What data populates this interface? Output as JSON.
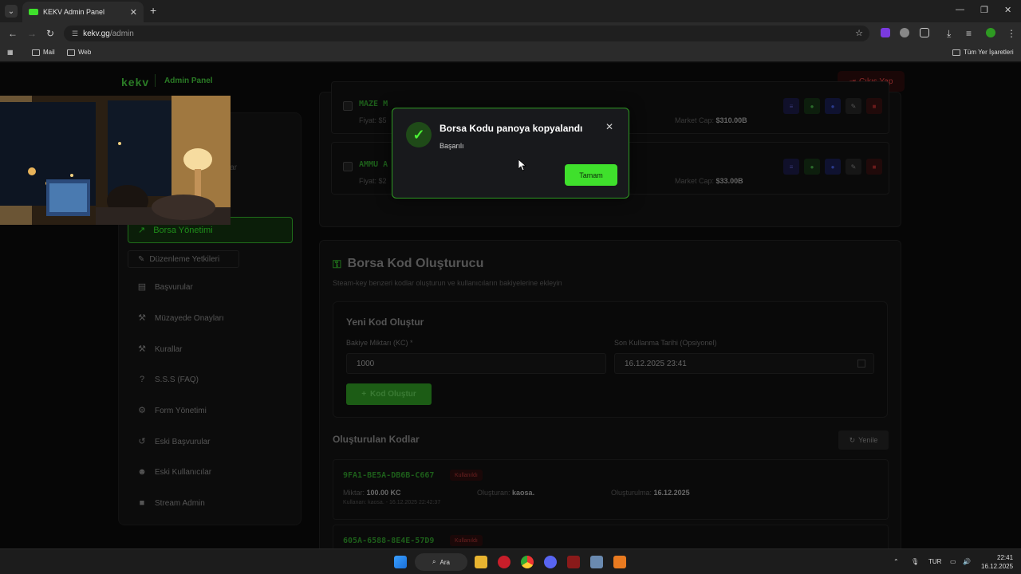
{
  "browser": {
    "tab_title": "KEKV Admin Panel",
    "url_host": "kekv.gg",
    "url_path": "/admin",
    "bookmarks": [
      "Mail",
      "Web"
    ],
    "all_bookmarks": "Tüm Yer İşaretleri"
  },
  "header": {
    "logo": "kekv",
    "title": "Admin Panel",
    "logout": "Çıkış Yap"
  },
  "sidebar": {
    "ghost_text": "lar",
    "active": "Borsa Yönetimi",
    "permissions": "Düzenleme Yetkileri",
    "items": [
      {
        "label": "Başvurular",
        "icon": "document-icon"
      },
      {
        "label": "Müzayede Onayları",
        "icon": "gavel-icon"
      },
      {
        "label": "Kurallar",
        "icon": "gavel-icon"
      },
      {
        "label": "S.S.S (FAQ)",
        "icon": "question-icon"
      },
      {
        "label": "Form Yönetimi",
        "icon": "gear-icon"
      },
      {
        "label": "Eski Başvurular",
        "icon": "history-icon"
      },
      {
        "label": "Eski Kullanıcılar",
        "icon": "users-icon"
      },
      {
        "label": "Stream Admin",
        "icon": "video-icon"
      }
    ]
  },
  "stocks": [
    {
      "code": "MAZE M",
      "price": "Fiyat: $5",
      "mcap_label": "Market Cap:",
      "mcap": "$310.00B"
    },
    {
      "code": "AMMU A",
      "price": "Fiyat: $2",
      "mcap_label": "Market Cap:",
      "mcap": "$33.00B"
    }
  ],
  "generator": {
    "title": "Borsa Kod Oluşturucu",
    "subtitle": "Steam-key benzeri kodlar oluşturun ve kullanıcıların bakiyelerine ekleyin",
    "new_title": "Yeni Kod Oluştur",
    "amount_label": "Bakiye Miktarı (KC) *",
    "amount_value": "1000",
    "expiry_label": "Son Kullanma Tarihi (Opsiyonel)",
    "expiry_value": "16.12.2025 23:41",
    "create_btn": "Kod Oluştur",
    "codes_title": "Oluşturulan Kodlar",
    "refresh": "Yenile"
  },
  "codes": [
    {
      "code": "9FA1-BE5A-DB6B-C667",
      "badge": "Kullanıldı",
      "amount_label": "Miktar:",
      "amount": "100.00 KC",
      "creator_label": "Oluşturan:",
      "creator": "kaosa.",
      "created_label": "Oluşturulma:",
      "created": "16.12.2025",
      "used_by": "Kullanan: kaosa. - 16.12.2025 22:42:37"
    },
    {
      "code": "605A-6588-8E4E-57D9",
      "badge": "Kullanıldı"
    }
  ],
  "modal": {
    "title": "Borsa Kodu panoya kopyalandı",
    "text": "Başarılı",
    "ok": "Tamam"
  },
  "taskbar": {
    "search": "Ara",
    "lang": "TUR",
    "time": "22:41",
    "date": "16.12.2025"
  },
  "colors": {
    "accent": "#3fe02c",
    "danger": "#8a2a2a"
  }
}
